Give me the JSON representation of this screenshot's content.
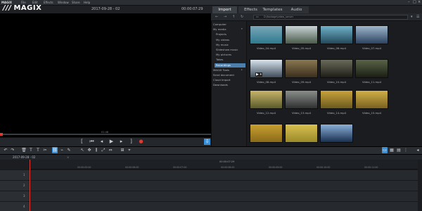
{
  "app": {
    "name": "MAGIX",
    "logo_text": "MAGIX",
    "menu": [
      "File",
      "Edit",
      "Effects",
      "Window",
      "Share",
      "Help"
    ]
  },
  "preview": {
    "project_title": "2017-09-28 - 02",
    "timecode": "00:00:07:29",
    "scrub_time": "01:48"
  },
  "media_pool": {
    "tabs": [
      "Import",
      "Effects",
      "Templates",
      "Audio"
    ],
    "active_tab": "Import",
    "path": "D:\\footage\\video_server",
    "sidebar": [
      {
        "label": "Computer",
        "level": 0
      },
      {
        "label": "My media",
        "level": 0,
        "expand": "▾"
      },
      {
        "label": "Projects",
        "level": 1
      },
      {
        "label": "My videos",
        "level": 1
      },
      {
        "label": "My music",
        "level": 1
      },
      {
        "label": "Slideshow music",
        "level": 1
      },
      {
        "label": "My pictures",
        "level": 1
      },
      {
        "label": "Takes",
        "level": 1
      },
      {
        "label": "Recordings",
        "level": 1,
        "selected": true
      },
      {
        "label": "MAGIX Tools",
        "level": 0,
        "expand": "▸"
      },
      {
        "label": "Send document",
        "level": 0
      },
      {
        "label": "Cloud Import",
        "level": 0
      },
      {
        "label": "Downloads",
        "level": 0
      }
    ],
    "files": [
      {
        "label": "Video_04.mp4",
        "colors": [
          "#7aa6b8",
          "#2e7a8e"
        ]
      },
      {
        "label": "Video_05.mp4",
        "colors": [
          "#c9d4d6",
          "#4a5a4a"
        ]
      },
      {
        "label": "Video_06.mp4",
        "colors": [
          "#6fb2c9",
          "#23485a"
        ]
      },
      {
        "label": "Video_07.mp4",
        "colors": [
          "#9fb8cc",
          "#2c4260"
        ]
      },
      {
        "label": "Video_08.mp4",
        "colors": [
          "#d8e4ee",
          "#3f4d5a"
        ]
      },
      {
        "label": "Video_09.mp4",
        "colors": [
          "#8a7850",
          "#3a2e1e"
        ]
      },
      {
        "label": "Video_10.mp4",
        "colors": [
          "#6a6a5a",
          "#1e1e18"
        ]
      },
      {
        "label": "Video_11.mp4",
        "colors": [
          "#5a6448",
          "#1a1e14"
        ]
      },
      {
        "label": "Video_12.mp4",
        "colors": [
          "#c8b56a",
          "#5a5a2a"
        ]
      },
      {
        "label": "Video_13.mp4",
        "colors": [
          "#8a8e8a",
          "#2e3030"
        ]
      },
      {
        "label": "Video_14.mp4",
        "colors": [
          "#c9a23a",
          "#6a5a20"
        ]
      },
      {
        "label": "Video_15.mp4",
        "colors": [
          "#d0b048",
          "#7a6020"
        ]
      },
      {
        "label": "",
        "colors": [
          "#c8a030",
          "#8a6a1a"
        ]
      },
      {
        "label": "",
        "colors": [
          "#d8c050",
          "#9a8a2a"
        ]
      },
      {
        "label": "",
        "colors": [
          "#8ab0d8",
          "#1a3050"
        ]
      }
    ]
  },
  "timeline": {
    "title": "2017-09-28 - 02",
    "close_label": "×",
    "ruler_mid": "00:00:07:29",
    "ruler_ticks": [
      "00:00:05:00",
      "00:00:06:00",
      "00:00:07:00",
      "00:00:08:00",
      "00:00:09:00",
      "00:00:10:00",
      "00:00:11:00",
      "00:00:12:00",
      "00:00:13:00"
    ],
    "tracks": [
      "1",
      "2",
      "3",
      "4"
    ]
  },
  "colors": {
    "accent": "#3a8fd6",
    "record": "#e03a2f",
    "selected": "#4a7fae"
  }
}
